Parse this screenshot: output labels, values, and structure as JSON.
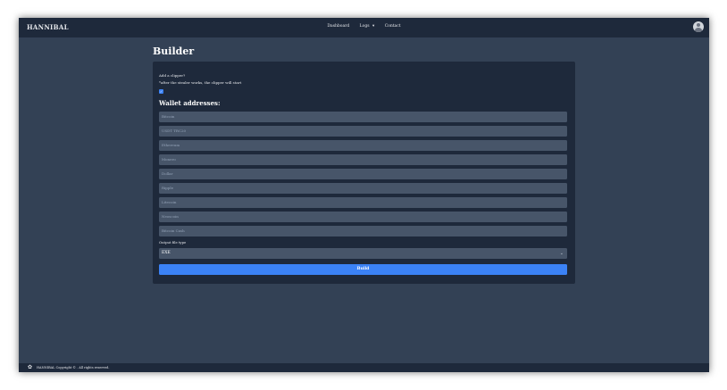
{
  "navbar": {
    "brand": "HANNIBAL",
    "links": [
      "Dashboard",
      "Logs",
      "Contact"
    ],
    "logs_caret": "▾",
    "avatar_icon": "user-avatar-icon"
  },
  "page": {
    "title": "Builder"
  },
  "panel": {
    "clipper_question": "Add a clipper?",
    "clipper_note": "*after the stealer works, the clipper will start",
    "clipper_checked": true,
    "check_mark": "✓",
    "wallets_heading": "Wallet addresses:",
    "wallet_placeholders": [
      "Bitcoin",
      "USDT TRC20",
      "Ethereum",
      "Monero",
      "Dollar",
      "Ripple",
      "Litecoin",
      "Neoscoin",
      "Bitcoin Cash"
    ],
    "output_label": "Output file type",
    "output_value": "EXE",
    "select_chevron": "⌄",
    "build_label": "Build"
  },
  "footer": {
    "icon": "paw-icon",
    "icon_glyph": "✿",
    "text": "HANNIBAL Copyright © . All rights reserved."
  },
  "colors": {
    "background": "#334155",
    "surface": "#1e293b",
    "input": "#475569",
    "accent": "#3b82f6"
  }
}
